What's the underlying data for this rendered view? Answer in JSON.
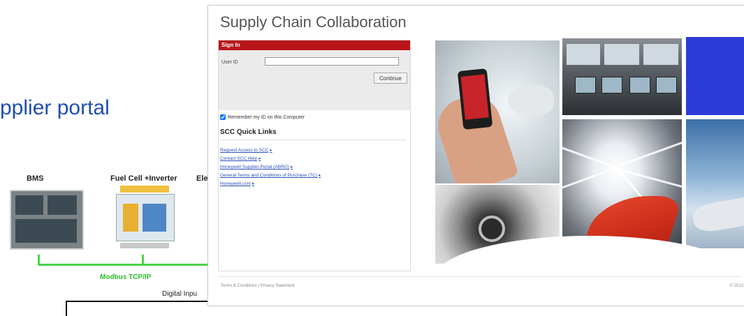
{
  "slide": {
    "title": "pplier portal",
    "diagram": {
      "bms_label": "BMS",
      "fuel_cell_label": "Fuel Cell +Inverter",
      "partial_label": "Ele",
      "bus_label": "Modbus TCP/IP",
      "digital_label": "Digital Inpu",
      "bus_color": "#4cd24c"
    }
  },
  "portal": {
    "title": "Supply Chain Collaboration",
    "signin": {
      "header": "Sign In",
      "user_id_label": "User ID",
      "user_id_value": "",
      "continue_label": "Continue",
      "remember_label": "Remember my ID on this Computer",
      "remember_checked": true
    },
    "quick_links": {
      "title": "SCC Quick Links",
      "items": [
        "Request Access to SCC",
        "Contact SCC Help",
        "Honeywell Supplier Portal (ABRO)",
        "General Terms and Conditions of Purchase (TC)",
        "Honeywell.com"
      ]
    },
    "footer": {
      "links": "Terms & Conditions | Privacy Statement",
      "copyright": "© 2013"
    },
    "accent_color": "#b8161b",
    "link_color": "#2a4fb8"
  }
}
